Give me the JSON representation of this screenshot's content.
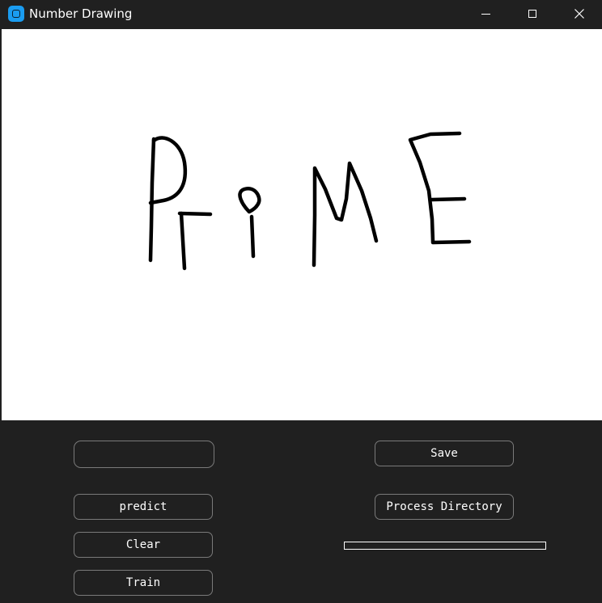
{
  "window": {
    "title": "Number Drawing",
    "icons": {
      "app": "app-icon",
      "minimize": "minimize-icon",
      "maximize": "maximize-icon",
      "close": "close-icon"
    }
  },
  "canvas": {
    "background": "#ffffff",
    "stroke_color": "#000000"
  },
  "controls": {
    "text_field_value": "",
    "save_label": "Save",
    "predict_label": "predict",
    "process_directory_label": "Process Directory",
    "clear_label": "Clear",
    "train_label": "Train",
    "progress_fraction": 0.0
  },
  "colors": {
    "window_bg": "#202020",
    "button_border": "#7a7a7a",
    "progress_border": "#ffffff",
    "progress_fill": "#1fb37a"
  }
}
